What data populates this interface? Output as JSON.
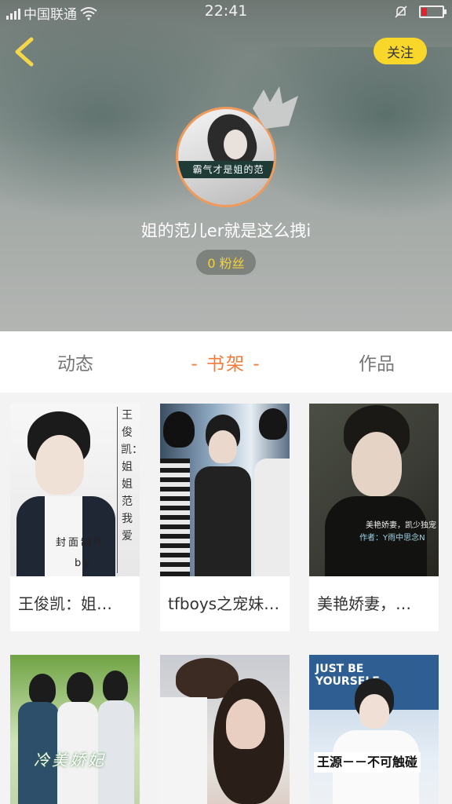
{
  "status_bar": {
    "carrier": "中国联通",
    "time": "22:41"
  },
  "header": {
    "follow_label": "关注",
    "username": "姐的范儿er就是这么拽i",
    "fans_label": "0 粉丝",
    "avatar_caption": "霸气才是姐的范"
  },
  "tabs": [
    {
      "label": "动态",
      "active": false
    },
    {
      "label": "- 书架 -",
      "active": true
    },
    {
      "label": "作品",
      "active": false
    }
  ],
  "books": [
    {
      "title": "王俊凯：姐…",
      "cover_text": "王俊凯：姐姐范我爱",
      "cover_caption": "封面制作",
      "cover_sub": "by"
    },
    {
      "title": "tfboys之宠妹…",
      "cover_text": ""
    },
    {
      "title": "美艳娇妻，…",
      "cover_text": "美艳娇妻，凯少独宠",
      "cover_sub": "作者：Y雨中思念N"
    },
    {
      "title": "",
      "cover_text": "冷美娇妃"
    },
    {
      "title": "",
      "cover_text": ""
    },
    {
      "title": "",
      "cover_text": "王源－－不可触碰",
      "cover_top": "JUST BE YOURSELF"
    }
  ]
}
